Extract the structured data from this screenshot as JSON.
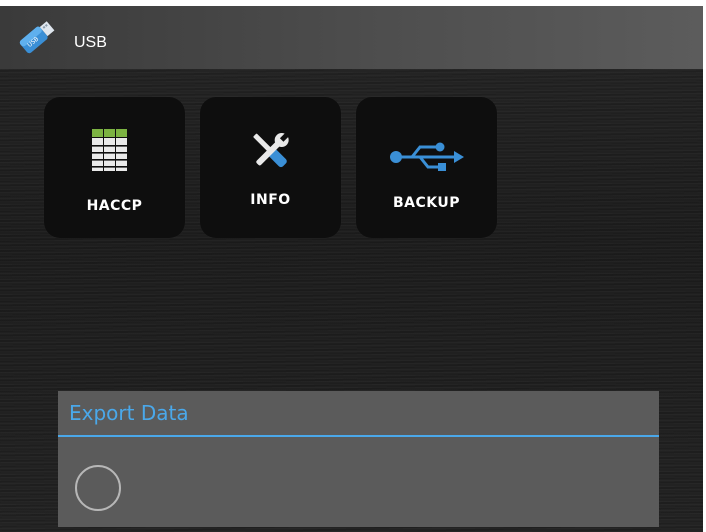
{
  "title_bar": {
    "title": "USB",
    "icon": "usb-stick-icon",
    "icon_badge_text": "USB"
  },
  "tiles": [
    {
      "label": "HACCP",
      "icon": "haccp-table-icon"
    },
    {
      "label": "INFO",
      "icon": "tools-icon"
    },
    {
      "label": "BACKUP",
      "icon": "usb-symbol-icon"
    }
  ],
  "export_panel": {
    "title": "Export Data",
    "progress_indicator": "spinner"
  },
  "colors": {
    "accent": "#4aa8ea",
    "haccp_green": "#7cb342",
    "usb_icon_blue": "#3a8fd6",
    "tile_background": "#0e0e0e",
    "panel_background": "#5b5b5b"
  }
}
